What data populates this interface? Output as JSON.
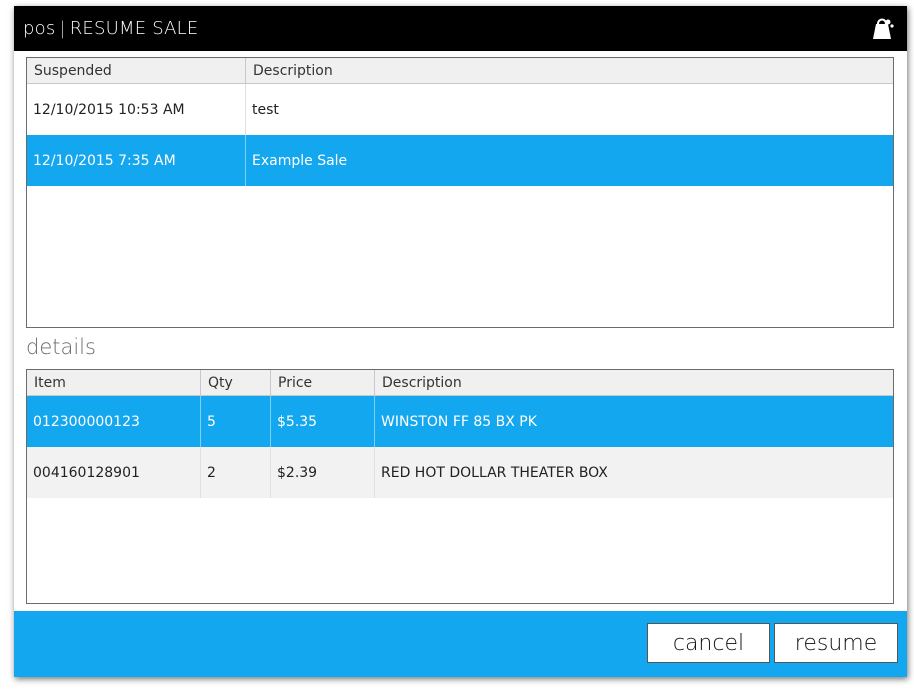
{
  "window": {
    "app_name": "pos",
    "separator": "|",
    "title": "RESUME SALE",
    "app_icon": "bag-icon"
  },
  "suspended_grid": {
    "columns": [
      "Suspended",
      "Description"
    ],
    "rows": [
      {
        "suspended": "12/10/2015 10:53 AM",
        "description": "test",
        "selected": false
      },
      {
        "suspended": "12/10/2015 7:35 AM",
        "description": "Example Sale",
        "selected": true
      }
    ]
  },
  "details": {
    "label": "details",
    "columns": [
      "Item",
      "Qty",
      "Price",
      "Description"
    ],
    "rows": [
      {
        "item": "012300000123",
        "qty": "5",
        "price": "$5.35",
        "description": "WINSTON FF 85 BX PK",
        "selected": true
      },
      {
        "item": "004160128901",
        "qty": "2",
        "price": "$2.39",
        "description": "RED HOT DOLLAR THEATER BOX",
        "selected": false
      }
    ]
  },
  "footer": {
    "cancel_label": "cancel",
    "resume_label": "resume"
  },
  "colors": {
    "accent": "#13a7ef",
    "titlebar": "#000000"
  }
}
